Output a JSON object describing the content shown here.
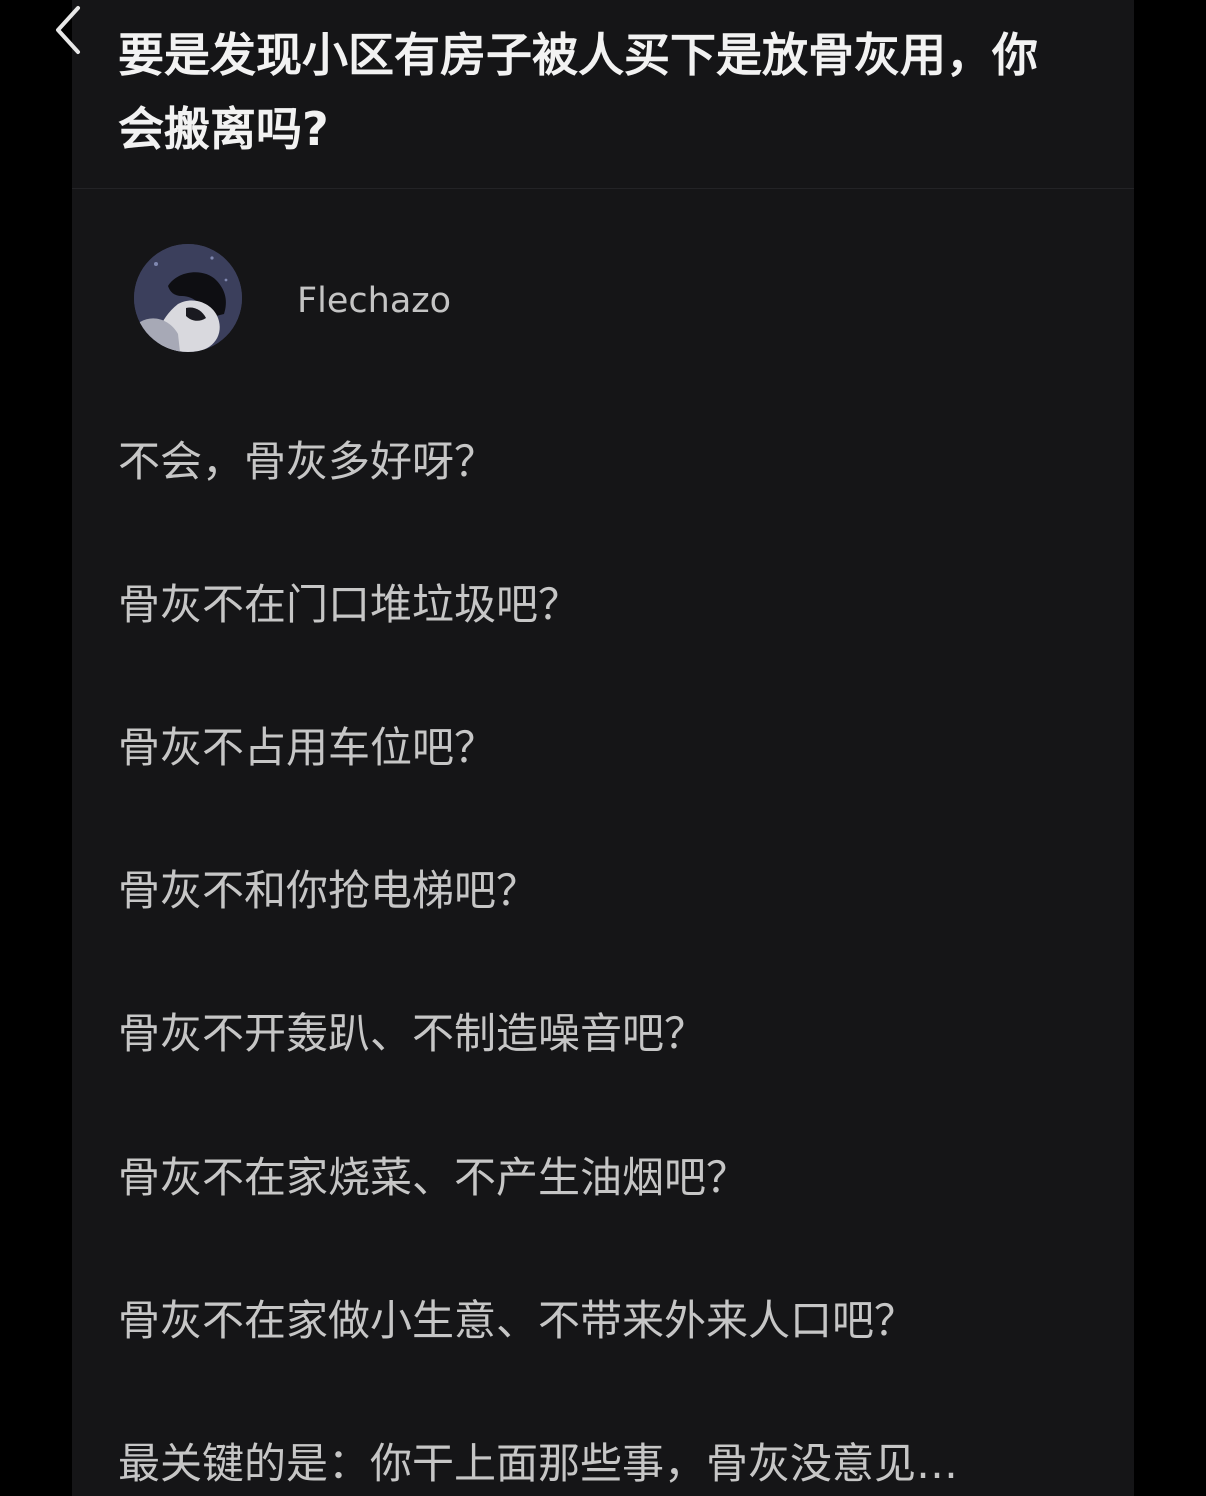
{
  "question": {
    "title": "要是发现小区有房子被人买下是放骨灰用，你会搬离吗?"
  },
  "answer": {
    "author": "Flechazo",
    "lines": [
      "不会，骨灰多好呀？",
      "骨灰不在门口堆垃圾吧？",
      "骨灰不占用车位吧？",
      "骨灰不和你抢电梯吧？",
      "骨灰不开轰趴、不制造噪音吧？",
      "骨灰不在家烧菜、不产生油烟吧？",
      "骨灰不在家做小生意、不带来外来人口吧？",
      "最关键的是：你干上面那些事，骨灰没意见…"
    ]
  },
  "icons": {
    "back": "chevron-left-icon"
  },
  "colors": {
    "page_background": "#000000",
    "panel_background": "#151517",
    "title_text": "#f2f2f2",
    "body_text": "#c6c6c6"
  }
}
